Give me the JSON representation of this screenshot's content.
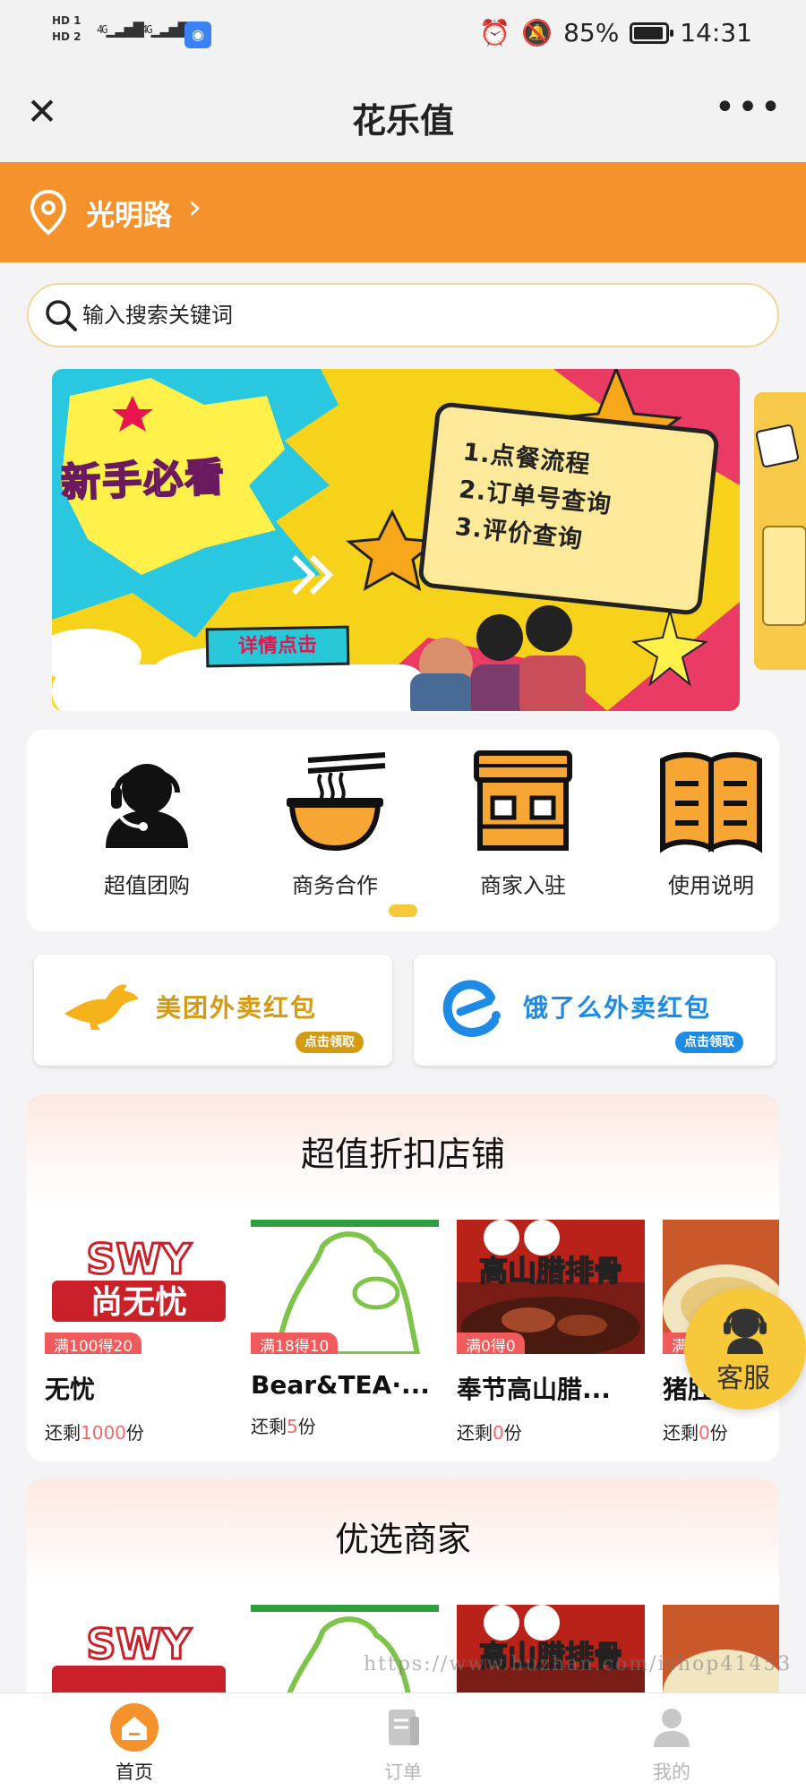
{
  "status_bar": {
    "sim1": "HD 1",
    "sim2": "HD 2",
    "signal1": "4G",
    "signal2": "4G",
    "battery": "85%",
    "time": "14:31"
  },
  "title_bar": {
    "title": "花乐值"
  },
  "location": {
    "name": "光明路"
  },
  "search": {
    "placeholder": "输入搜索关键词"
  },
  "banner": {
    "title": "新手必看",
    "items": [
      "1.点餐流程",
      "2.订单号查询",
      "3.评价查询"
    ],
    "button": "详情点击"
  },
  "quick_links": [
    {
      "label": "超值团购",
      "icon": "customer-service-icon"
    },
    {
      "label": "商务合作",
      "icon": "noodle-bowl-icon"
    },
    {
      "label": "商家入驻",
      "icon": "storefront-icon"
    },
    {
      "label": "使用说明",
      "icon": "book-icon"
    }
  ],
  "red_packets": [
    {
      "title": "美团外卖红包",
      "tag": "点击领取",
      "icon": "kangaroo-icon",
      "color": "#d49b12"
    },
    {
      "title": "饿了么外卖红包",
      "tag": "点击领取",
      "icon": "eleme-icon",
      "color": "#1d8be6"
    }
  ],
  "discount_section": {
    "title": "超值折扣店铺",
    "shops": [
      {
        "name": "无忧",
        "badge": "满100得20",
        "stock_prefix": "还剩",
        "stock": "1000",
        "stock_suffix": "份",
        "logo_text": "SWY",
        "logo_sub": "尚无忧"
      },
      {
        "name": "Bear&TEA·...",
        "badge": "满18得10",
        "stock_prefix": "还剩",
        "stock": "5",
        "stock_suffix": "份"
      },
      {
        "name": "奉节高山腊...",
        "badge": "满0得0",
        "stock_prefix": "还剩",
        "stock": "0",
        "stock_suffix": "份",
        "logo_text": "高山腊排骨"
      },
      {
        "name": "猪肚",
        "badge": "满",
        "stock_prefix": "还剩",
        "stock": "0",
        "stock_suffix": "份"
      }
    ]
  },
  "preferred_section": {
    "title": "优选商家"
  },
  "customer_service": {
    "label": "客服"
  },
  "watermark": "https://www.huzhan.com/ishop41453",
  "tabs": [
    {
      "label": "首页",
      "icon": "home-icon",
      "active": true
    },
    {
      "label": "订单",
      "icon": "order-icon",
      "active": false
    },
    {
      "label": "我的",
      "icon": "user-icon",
      "active": false
    }
  ],
  "colors": {
    "accent": "#f5922b",
    "highlight": "#f7c93a",
    "discount_badge": "#f15a5a"
  }
}
